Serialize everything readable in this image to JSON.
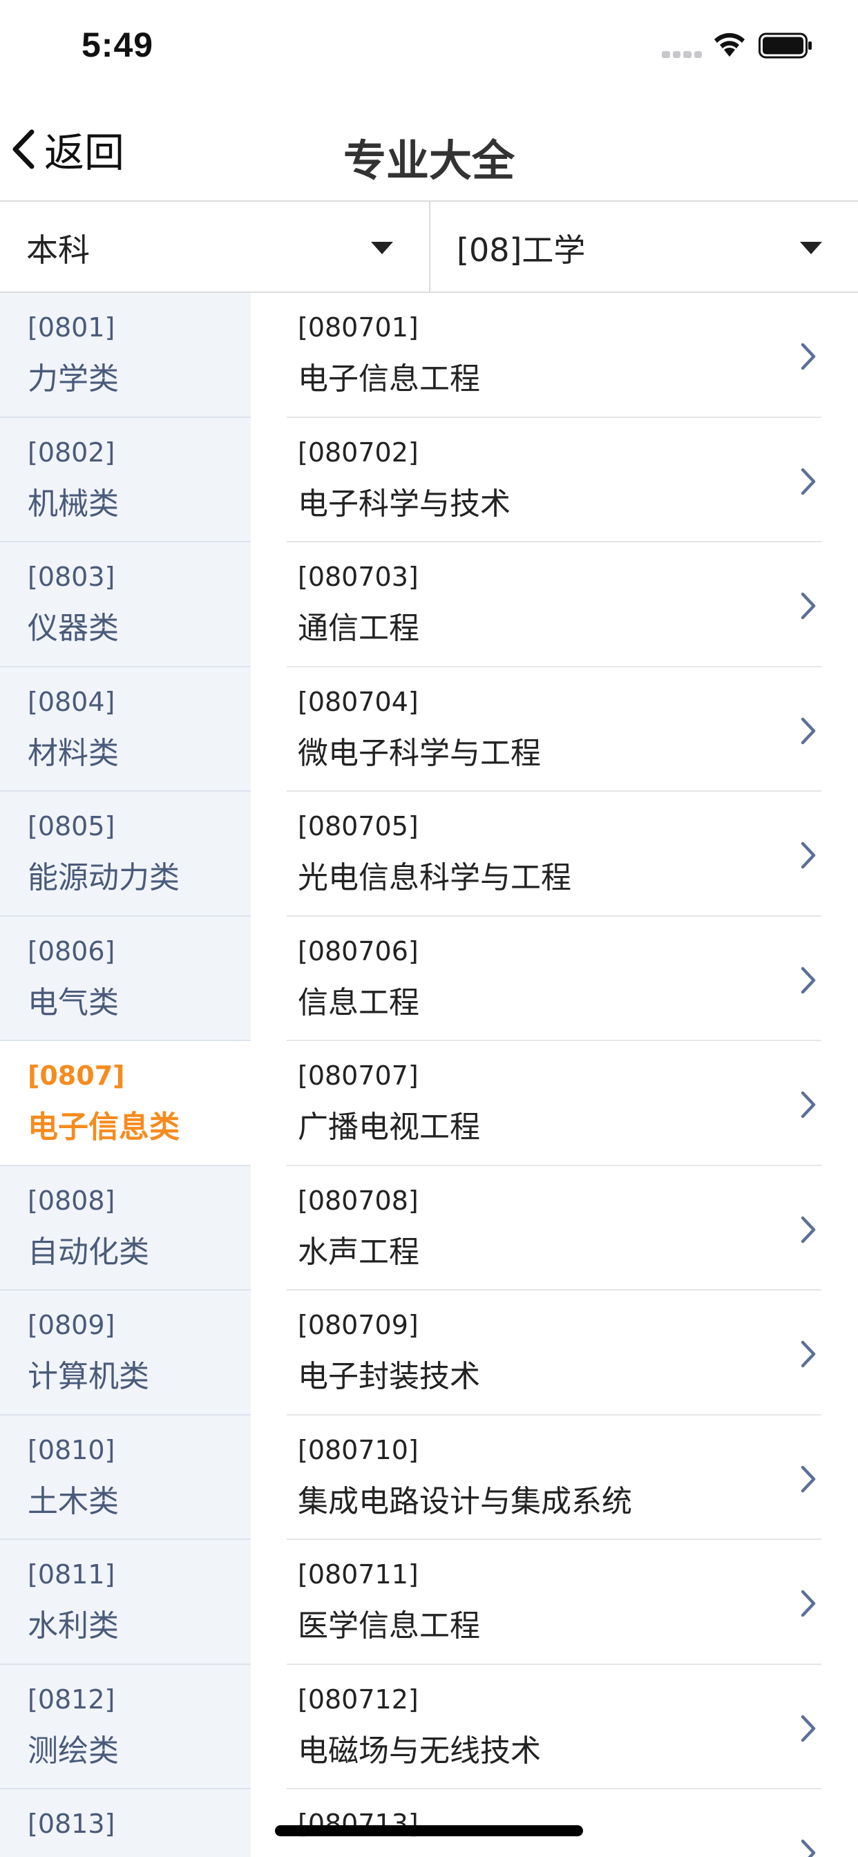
{
  "status_bar": {
    "time": "5:49"
  },
  "nav": {
    "back_label": "返回",
    "title": "专业大全"
  },
  "filters": {
    "level": "本科",
    "discipline": "[08]工学"
  },
  "categories": [
    {
      "code": "[0801]",
      "name": "力学类"
    },
    {
      "code": "[0802]",
      "name": "机械类"
    },
    {
      "code": "[0803]",
      "name": "仪器类"
    },
    {
      "code": "[0804]",
      "name": "材料类"
    },
    {
      "code": "[0805]",
      "name": "能源动力类"
    },
    {
      "code": "[0806]",
      "name": "电气类"
    },
    {
      "code": "[0807]",
      "name": "电子信息类"
    },
    {
      "code": "[0808]",
      "name": "自动化类"
    },
    {
      "code": "[0809]",
      "name": "计算机类"
    },
    {
      "code": "[0810]",
      "name": "土木类"
    },
    {
      "code": "[0811]",
      "name": "水利类"
    },
    {
      "code": "[0812]",
      "name": "测绘类"
    },
    {
      "code": "[0813]",
      "name": ""
    }
  ],
  "active_category_index": 6,
  "majors": [
    {
      "code": "[080701]",
      "name": "电子信息工程"
    },
    {
      "code": "[080702]",
      "name": "电子科学与技术"
    },
    {
      "code": "[080703]",
      "name": "通信工程"
    },
    {
      "code": "[080704]",
      "name": "微电子科学与工程"
    },
    {
      "code": "[080705]",
      "name": "光电信息科学与工程"
    },
    {
      "code": "[080706]",
      "name": "信息工程"
    },
    {
      "code": "[080707]",
      "name": "广播电视工程"
    },
    {
      "code": "[080708]",
      "name": "水声工程"
    },
    {
      "code": "[080709]",
      "name": "电子封装技术"
    },
    {
      "code": "[080710]",
      "name": "集成电路设计与集成系统"
    },
    {
      "code": "[080711]",
      "name": "医学信息工程"
    },
    {
      "code": "[080712]",
      "name": "电磁场与无线技术"
    },
    {
      "code": "[080713]",
      "name": ""
    }
  ],
  "colors": {
    "accent": "#f68b1e",
    "category_text": "#4a5a7a",
    "sidebar_bg": "#f1f4f9",
    "chevron": "#5b6f99"
  },
  "icons": {
    "back": "chevron-left-icon",
    "dropdown": "caret-down-icon",
    "row": "chevron-right-icon"
  }
}
